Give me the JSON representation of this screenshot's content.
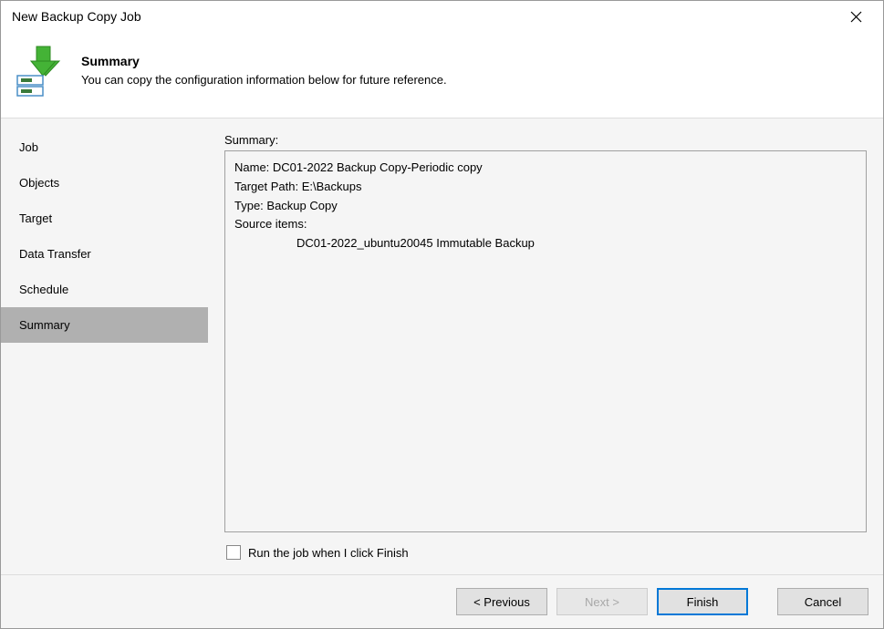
{
  "titlebar": {
    "title": "New Backup Copy Job"
  },
  "header": {
    "title": "Summary",
    "subtitle": "You can copy the configuration information below for future reference."
  },
  "sidebar": {
    "items": [
      {
        "label": "Job"
      },
      {
        "label": "Objects"
      },
      {
        "label": "Target"
      },
      {
        "label": "Data Transfer"
      },
      {
        "label": "Schedule"
      },
      {
        "label": "Summary"
      }
    ]
  },
  "main": {
    "panel_label": "Summary:",
    "summary": {
      "name_line": "Name: DC01-2022 Backup Copy-Periodic copy",
      "target_line": "Target Path: E:\\Backups",
      "type_line": "Type: Backup Copy",
      "source_items_label": "Source items:",
      "source_item_1": "DC01-2022_ubuntu20045 Immutable Backup"
    },
    "checkbox_label": "Run the job when I click Finish"
  },
  "footer": {
    "previous": "< Previous",
    "next": "Next >",
    "finish": "Finish",
    "cancel": "Cancel"
  }
}
